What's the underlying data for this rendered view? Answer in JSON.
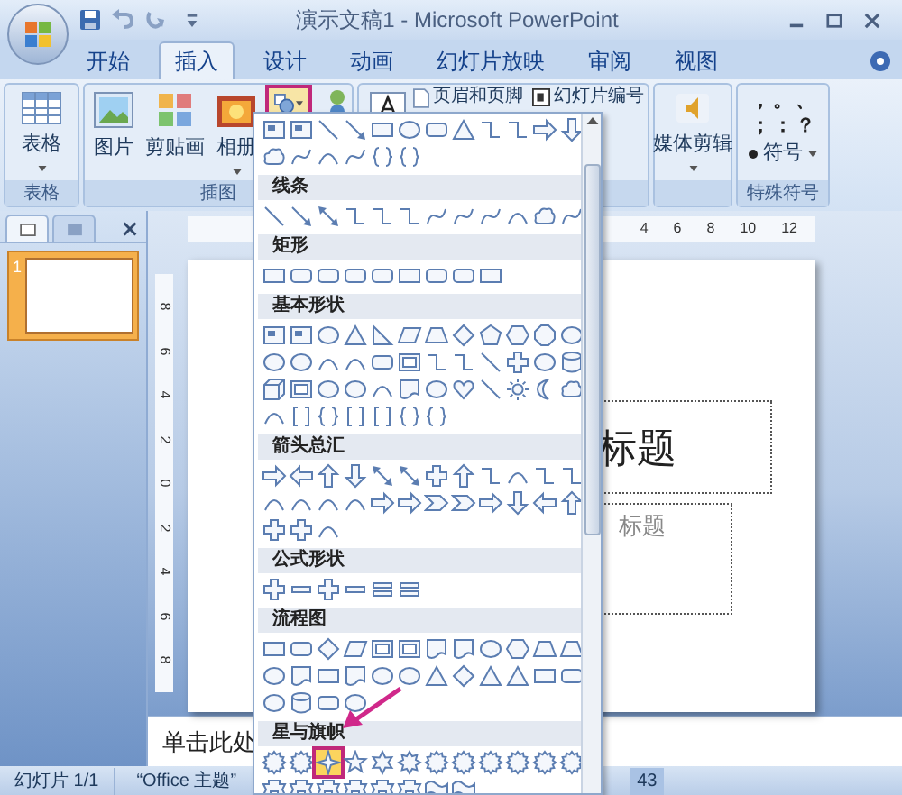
{
  "window": {
    "title": "演示文稿1 - Microsoft PowerPoint"
  },
  "tabs": [
    {
      "label": "开始",
      "selected": false
    },
    {
      "label": "插入",
      "selected": true
    },
    {
      "label": "设计",
      "selected": false
    },
    {
      "label": "动画",
      "selected": false
    },
    {
      "label": "幻灯片放映",
      "selected": false
    },
    {
      "label": "审阅",
      "selected": false
    },
    {
      "label": "视图",
      "selected": false
    }
  ],
  "ribbon": {
    "table_group": {
      "label": "表格",
      "button": "表格"
    },
    "illustrations_group": {
      "label": "插图",
      "buttons": [
        "图片",
        "剪贴画",
        "相册"
      ]
    },
    "text_group": {
      "buttons": [
        "页眉和页脚",
        "幻灯片编号"
      ]
    },
    "media_group": {
      "button": "媒体剪辑"
    },
    "symbols_group": {
      "label": "特殊符号",
      "symbols": [
        "，",
        "。",
        "、",
        "；",
        "：",
        "？"
      ],
      "button": "符号"
    }
  },
  "shapes_menu": {
    "expanded": true,
    "sections": [
      {
        "shapes": [
          {
            "kind": "textbox"
          },
          {
            "kind": "textbox"
          },
          {
            "kind": "line"
          },
          {
            "kind": "arrow"
          },
          {
            "kind": "rect"
          },
          {
            "kind": "oval"
          },
          {
            "kind": "rrect"
          },
          {
            "kind": "tri"
          },
          {
            "kind": "elbow"
          },
          {
            "kind": "elbow"
          },
          {
            "kind": "block-r"
          },
          {
            "kind": "block-d"
          },
          {
            "kind": "cloud"
          },
          {
            "kind": "curve"
          },
          {
            "kind": "arc"
          },
          {
            "kind": "curve"
          },
          {
            "kind": "brace"
          },
          {
            "kind": "brace"
          }
        ]
      },
      {
        "title": "线条",
        "shapes": [
          {
            "kind": "line"
          },
          {
            "kind": "arrow"
          },
          {
            "kind": "dblarrow"
          },
          {
            "kind": "elbow"
          },
          {
            "kind": "elbow"
          },
          {
            "kind": "elbow"
          },
          {
            "kind": "curve"
          },
          {
            "kind": "curve"
          },
          {
            "kind": "curve"
          },
          {
            "kind": "arc"
          },
          {
            "kind": "cloud"
          },
          {
            "kind": "curve"
          }
        ]
      },
      {
        "title": "矩形",
        "shapes": [
          {
            "kind": "rect"
          },
          {
            "kind": "rrect"
          },
          {
            "kind": "rrect"
          },
          {
            "kind": "rrect"
          },
          {
            "kind": "rrect"
          },
          {
            "kind": "rect"
          },
          {
            "kind": "rrect"
          },
          {
            "kind": "rrect"
          },
          {
            "kind": "rect"
          }
        ]
      },
      {
        "title": "基本形状",
        "shapes": [
          {
            "kind": "textbox"
          },
          {
            "kind": "textbox"
          },
          {
            "kind": "oval"
          },
          {
            "kind": "tri"
          },
          {
            "kind": "rtri"
          },
          {
            "kind": "para"
          },
          {
            "kind": "trap"
          },
          {
            "kind": "diamond"
          },
          {
            "kind": "pent"
          },
          {
            "kind": "hex"
          },
          {
            "kind": "octagon"
          },
          {
            "kind": "oval"
          },
          {
            "kind": "oval"
          },
          {
            "kind": "oval"
          },
          {
            "kind": "arc"
          },
          {
            "kind": "arc"
          },
          {
            "kind": "rrect"
          },
          {
            "kind": "frame"
          },
          {
            "kind": "elbow"
          },
          {
            "kind": "elbow"
          },
          {
            "kind": "line"
          },
          {
            "kind": "cross"
          },
          {
            "kind": "oval"
          },
          {
            "kind": "can"
          },
          {
            "kind": "cube"
          },
          {
            "kind": "frame"
          },
          {
            "kind": "oval"
          },
          {
            "kind": "oval"
          },
          {
            "kind": "arc"
          },
          {
            "kind": "doc"
          },
          {
            "kind": "oval"
          },
          {
            "kind": "heart"
          },
          {
            "kind": "line"
          },
          {
            "kind": "sun"
          },
          {
            "kind": "moon"
          },
          {
            "kind": "cloud"
          },
          {
            "kind": "arc"
          },
          {
            "kind": "bracket"
          },
          {
            "kind": "brace"
          },
          {
            "kind": "bracket"
          },
          {
            "kind": "bracket"
          },
          {
            "kind": "brace"
          },
          {
            "kind": "brace"
          }
        ]
      },
      {
        "title": "箭头总汇",
        "shapes": [
          {
            "kind": "block-r"
          },
          {
            "kind": "block-l"
          },
          {
            "kind": "block-u"
          },
          {
            "kind": "block-d"
          },
          {
            "kind": "dblarrow"
          },
          {
            "kind": "dblarrow"
          },
          {
            "kind": "cross"
          },
          {
            "kind": "block-u"
          },
          {
            "kind": "elbow"
          },
          {
            "kind": "arc"
          },
          {
            "kind": "elbow"
          },
          {
            "kind": "elbow"
          },
          {
            "kind": "arc"
          },
          {
            "kind": "arc"
          },
          {
            "kind": "arc"
          },
          {
            "kind": "arc"
          },
          {
            "kind": "block-r"
          },
          {
            "kind": "block-r"
          },
          {
            "kind": "chevron"
          },
          {
            "kind": "chevron"
          },
          {
            "kind": "block-r"
          },
          {
            "kind": "block-d"
          },
          {
            "kind": "block-l"
          },
          {
            "kind": "block-u"
          },
          {
            "kind": "cross"
          },
          {
            "kind": "cross"
          },
          {
            "kind": "arc"
          }
        ]
      },
      {
        "title": "公式形状",
        "shapes": [
          {
            "kind": "cross"
          },
          {
            "kind": "minus"
          },
          {
            "kind": "cross"
          },
          {
            "kind": "minus"
          },
          {
            "kind": "equal"
          },
          {
            "kind": "equal"
          }
        ]
      },
      {
        "title": "流程图",
        "shapes": [
          {
            "kind": "rect"
          },
          {
            "kind": "rrect"
          },
          {
            "kind": "diamond"
          },
          {
            "kind": "para"
          },
          {
            "kind": "frame"
          },
          {
            "kind": "frame"
          },
          {
            "kind": "doc"
          },
          {
            "kind": "doc"
          },
          {
            "kind": "oval"
          },
          {
            "kind": "hex"
          },
          {
            "kind": "trap"
          },
          {
            "kind": "trap"
          },
          {
            "kind": "oval"
          },
          {
            "kind": "doc"
          },
          {
            "kind": "rect"
          },
          {
            "kind": "doc"
          },
          {
            "kind": "oval"
          },
          {
            "kind": "oval"
          },
          {
            "kind": "tri"
          },
          {
            "kind": "diamond"
          },
          {
            "kind": "tri"
          },
          {
            "kind": "tri"
          },
          {
            "kind": "rect"
          },
          {
            "kind": "rrect"
          },
          {
            "kind": "oval"
          },
          {
            "kind": "can"
          },
          {
            "kind": "rrect"
          },
          {
            "kind": "oval"
          }
        ]
      },
      {
        "title": "星与旗帜",
        "shapes": [
          {
            "kind": "burst",
            "selected": false
          },
          {
            "kind": "burst",
            "selected": false
          },
          {
            "kind": "star4",
            "selected": true
          },
          {
            "kind": "star5",
            "selected": false
          },
          {
            "kind": "star6",
            "selected": false
          },
          {
            "kind": "star8",
            "selected": false
          },
          {
            "kind": "burst",
            "selected": false
          },
          {
            "kind": "burst",
            "selected": false
          },
          {
            "kind": "burst",
            "selected": false
          },
          {
            "kind": "burst",
            "selected": false
          },
          {
            "kind": "burst",
            "selected": false
          },
          {
            "kind": "burst",
            "selected": false
          },
          {
            "kind": "banner",
            "selected": false
          },
          {
            "kind": "banner",
            "selected": false
          },
          {
            "kind": "banner",
            "selected": false
          },
          {
            "kind": "banner",
            "selected": false
          },
          {
            "kind": "banner",
            "selected": false
          },
          {
            "kind": "banner",
            "selected": false
          },
          {
            "kind": "wave",
            "selected": false
          },
          {
            "kind": "wave",
            "selected": false
          }
        ]
      }
    ]
  },
  "slides_panel": {
    "slides": [
      {
        "number": "1",
        "selected": true
      }
    ]
  },
  "rulers": {
    "horizontal": [
      "4",
      "6",
      "8",
      "10",
      "12"
    ],
    "vertical": [
      "8",
      "6",
      "4",
      "2",
      "0",
      "2",
      "4",
      "6",
      "8"
    ]
  },
  "slide": {
    "title_placeholder": "标题",
    "subtitle_placeholder": "标题"
  },
  "notes": {
    "placeholder": "单击此处"
  },
  "status_bar": {
    "slide": "幻灯片 1/1",
    "theme": "“Office 主题”",
    "zoom": "43"
  }
}
